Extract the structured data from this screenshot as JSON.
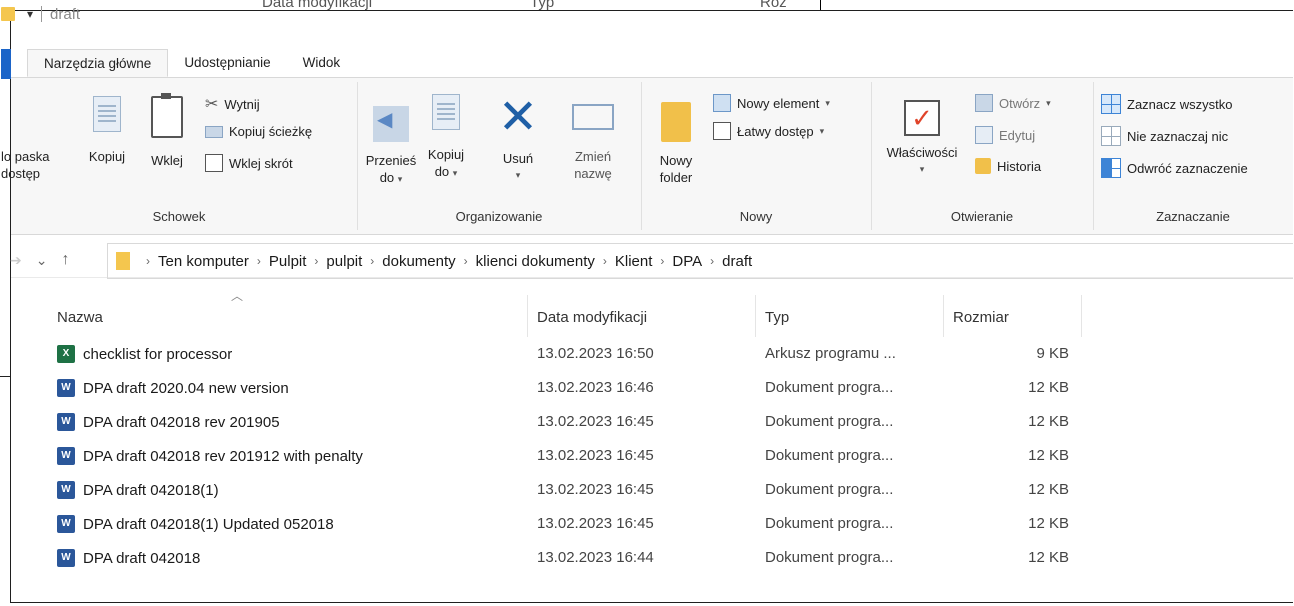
{
  "background_window": {
    "col1": "Data modyfikacji",
    "col2": "Typ",
    "col3": "Roz"
  },
  "titlebar": {
    "title": "draft",
    "qa_dropdown": "▾"
  },
  "ribbon_tabs": [
    "Narzędzia główne",
    "Udostępnianie",
    "Widok"
  ],
  "ribbon": {
    "schowek": {
      "pin_label_line1": "lo paska",
      "pin_label_line2": "dostęp",
      "copy": "Kopiuj",
      "paste": "Wklej",
      "cut": "Wytnij",
      "copy_path": "Kopiuj ścieżkę",
      "paste_shortcut": "Wklej skrót",
      "group": "Schowek"
    },
    "organizowanie": {
      "move_to_line1": "Przenieś",
      "move_to_line2": "do",
      "copy_to_line1": "Kopiuj",
      "copy_to_line2": "do",
      "delete": "Usuń",
      "rename_line1": "Zmień",
      "rename_line2": "nazwę",
      "group": "Organizowanie"
    },
    "nowy": {
      "new_folder_line1": "Nowy",
      "new_folder_line2": "folder",
      "new_item": "Nowy element",
      "easy_access": "Łatwy dostęp",
      "group": "Nowy"
    },
    "otwieranie": {
      "properties": "Właściwości",
      "open": "Otwórz",
      "edit": "Edytuj",
      "history": "Historia",
      "group": "Otwieranie"
    },
    "zaznaczanie": {
      "select_all": "Zaznacz wszystko",
      "select_none": "Nie zaznaczaj nic",
      "invert": "Odwróć zaznaczenie",
      "group": "Zaznaczanie"
    }
  },
  "breadcrumb": [
    "Ten komputer",
    "Pulpit",
    "pulpit",
    "dokumenty",
    "klienci dokumenty",
    "Klient",
    "DPA",
    "draft"
  ],
  "columns": {
    "name": "Nazwa",
    "date": "Data modyfikacji",
    "type": "Typ",
    "size": "Rozmiar"
  },
  "files": [
    {
      "name": "checklist for processor",
      "date": "13.02.2023 16:50",
      "type": "Arkusz programu ...",
      "size": "9 KB",
      "icon": "excel-icon",
      "glyph": "X"
    },
    {
      "name": "DPA draft 2020.04 new version",
      "date": "13.02.2023 16:46",
      "type": "Dokument progra...",
      "size": "12 KB",
      "icon": "word-icon",
      "glyph": "W"
    },
    {
      "name": "DPA draft 042018 rev 201905",
      "date": "13.02.2023 16:45",
      "type": "Dokument progra...",
      "size": "12 KB",
      "icon": "word-icon",
      "glyph": "W"
    },
    {
      "name": "DPA draft 042018 rev 201912 with penalty",
      "date": "13.02.2023 16:45",
      "type": "Dokument progra...",
      "size": "12 KB",
      "icon": "word-icon",
      "glyph": "W"
    },
    {
      "name": "DPA draft 042018(1)",
      "date": "13.02.2023 16:45",
      "type": "Dokument progra...",
      "size": "12 KB",
      "icon": "word-icon",
      "glyph": "W"
    },
    {
      "name": "DPA draft 042018(1) Updated 052018",
      "date": "13.02.2023 16:45",
      "type": "Dokument progra...",
      "size": "12 KB",
      "icon": "word-icon",
      "glyph": "W"
    },
    {
      "name": "DPA draft 042018",
      "date": "13.02.2023 16:44",
      "type": "Dokument progra...",
      "size": "12 KB",
      "icon": "word-icon",
      "glyph": "W"
    }
  ]
}
